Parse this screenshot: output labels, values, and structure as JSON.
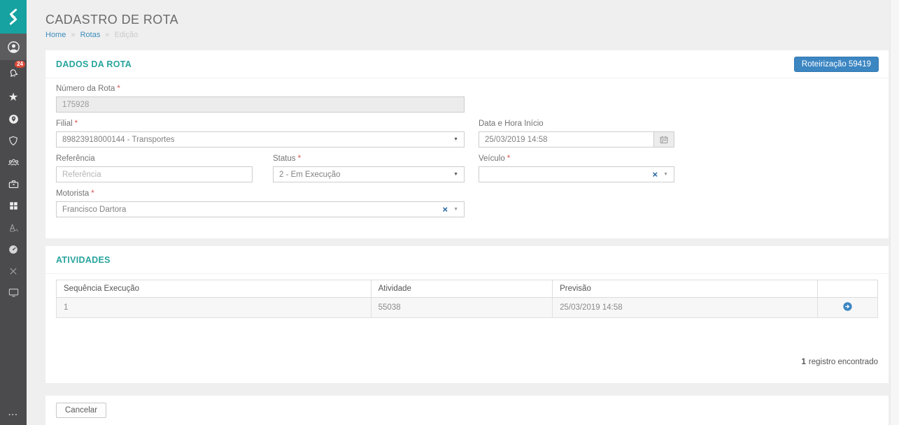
{
  "icons": {
    "clear": "×",
    "caret": "▼",
    "star": "★",
    "ellipsis": "···",
    "breadcrumb_separator": "»"
  },
  "sidebar": {
    "badge_count": "24"
  },
  "header": {
    "title": "CADASTRO DE ROTA",
    "breadcrumb": [
      "Home",
      "Rotas",
      "Edição"
    ]
  },
  "route_panel": {
    "title": "DADOS DA ROTA",
    "action_button": "Roteirização 59419",
    "required_marker": "*",
    "fields": {
      "numero": {
        "label": "Número da Rota",
        "value": "175928"
      },
      "filial": {
        "label": "Filial",
        "value": "89823918000144 - Transportes"
      },
      "data_inicio": {
        "label": "Data e Hora Início",
        "value": "25/03/2019 14:58"
      },
      "referencia": {
        "label": "Referência",
        "placeholder": "Referência",
        "value": ""
      },
      "status": {
        "label": "Status",
        "value": "2 - Em Execução"
      },
      "veiculo": {
        "label": "Veículo",
        "value": ""
      },
      "motorista": {
        "label": "Motorista",
        "value": "Francisco Dartora"
      }
    }
  },
  "activities_panel": {
    "title": "ATIVIDADES",
    "table": {
      "columns": [
        "Sequência Execução",
        "Atividade",
        "Previsão"
      ],
      "rows": [
        {
          "sequencia": "1",
          "atividade": "55038",
          "previsao": "25/03/2019 14:58"
        }
      ]
    },
    "count_number": "1",
    "count_text": "registro encontrado"
  },
  "footer": {
    "cancel_label": "Cancelar"
  },
  "colors": {
    "teal": "#16a2a0",
    "sidebar": "#4b4b4d",
    "blue": "#3c8dbc",
    "badge_red": "#dd4b39",
    "panel_title_teal": "#27a49c"
  }
}
